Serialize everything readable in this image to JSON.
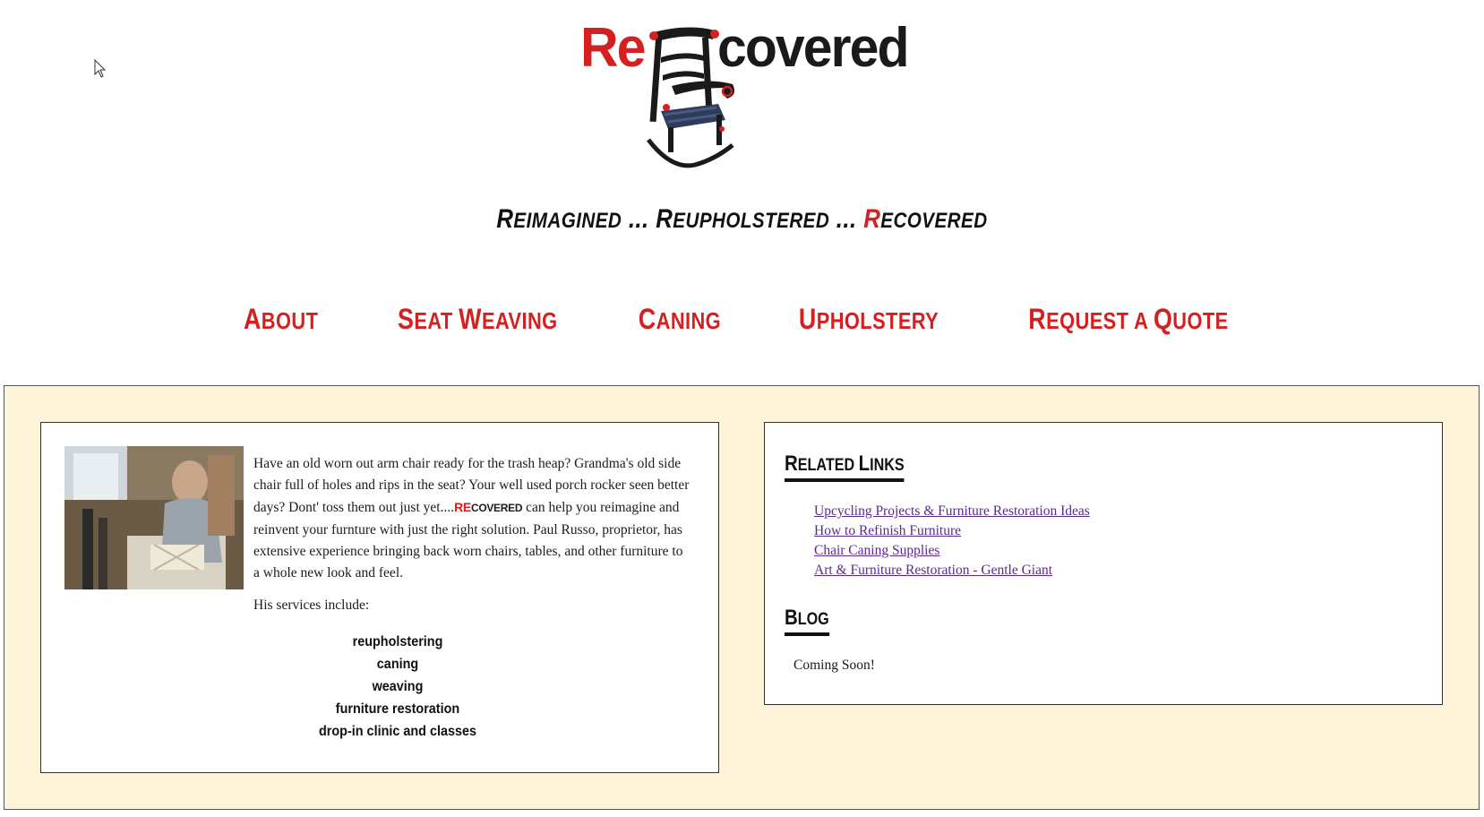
{
  "header": {
    "logo_re": "Re",
    "logo_covered": "covered",
    "tagline": {
      "w1_first": "R",
      "w1_rest": "EIMAGINED",
      "sep1": " ... ",
      "w2_first": "R",
      "w2_rest": "EUPHOLSTERED",
      "sep2": " ... ",
      "w3_first": "R",
      "w3_rest": "ECOVERED"
    }
  },
  "nav": [
    {
      "first": "A",
      "rest": "BOUT"
    },
    {
      "first": "S",
      "rest": "EAT ",
      "first2": "W",
      "rest2": "EAVING"
    },
    {
      "first": "C",
      "rest": "ANING"
    },
    {
      "first": "U",
      "rest": "PHOLSTERY"
    },
    {
      "first": "R",
      "rest": "EQUEST A ",
      "first2": "Q",
      "rest2": "UOTE"
    }
  ],
  "about": {
    "intro_part1": "Have an old worn out arm chair ready for the trash heap? Grandma's old side chair full of holes and rips in the seat? Your well used porch rocker seen better days? Dont' toss them out just yet....",
    "brand_re": "RE",
    "brand_rest": "COVERED",
    "intro_part2": " can help you reimagine and reinvent your furnture with just the right solution. Paul Russo, proprietor, has extensive experience bringing back worn chairs, tables, and other furniture to a whole new look and feel.",
    "services_label": "His services include:",
    "services": [
      "reupholstering",
      "caning",
      "weaving",
      "furniture restoration",
      "drop-in clinic and classes"
    ]
  },
  "sidebar": {
    "related_first": "R",
    "related_rest": "ELATED ",
    "related_first2": "L",
    "related_rest2": "INKS",
    "links": [
      "Upcycling Projects & Furniture Restoration Ideas",
      "How to Refinish Furniture",
      "Chair Caning Supplies",
      "Art & Furniture Restoration - Gentle Giant"
    ],
    "blog_first": "B",
    "blog_rest": "LOG",
    "blog_text": "Coming Soon!"
  },
  "colors": {
    "brand_red": "#d42020",
    "panel_bg": "#fdf4d9",
    "link": "#5a2a8c"
  }
}
